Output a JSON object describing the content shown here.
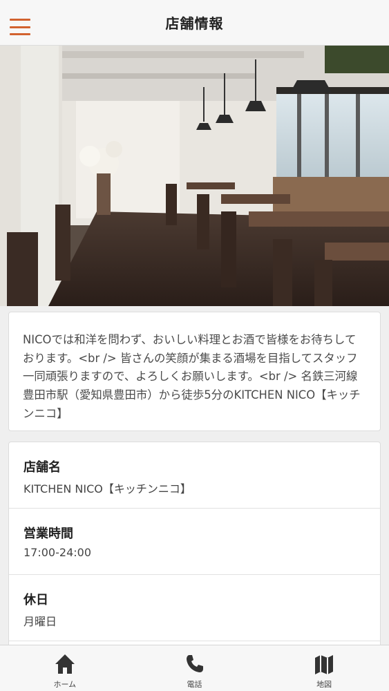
{
  "header": {
    "title": "店舗情報",
    "menu_icon": "hamburger-icon",
    "accent_color": "#d2622f"
  },
  "hero": {
    "image": "restaurant-interior-photo"
  },
  "description": {
    "text": "NICOでは和洋を問わず、おいしい料理とお酒で皆様をお待ちしております。<br /> 皆さんの笑顔が集まる酒場を目指してスタッフ一同頑張りますので、よろしくお願いします。<br /> 名鉄三河線豊田市駅（愛知県豊田市）から徒歩5分のKITCHEN NICO【キッチンニコ】"
  },
  "info": {
    "rows": [
      {
        "label": "店舗名",
        "value": "KITCHEN NICO【キッチンニコ】"
      },
      {
        "label": "営業時間",
        "value": "17:00-24:00"
      },
      {
        "label": "休日",
        "value": "月曜日"
      }
    ]
  },
  "tabbar": {
    "tabs": [
      {
        "label": "ホーム",
        "icon": "home-icon"
      },
      {
        "label": "電話",
        "icon": "phone-icon"
      },
      {
        "label": "地図",
        "icon": "map-icon"
      }
    ]
  }
}
